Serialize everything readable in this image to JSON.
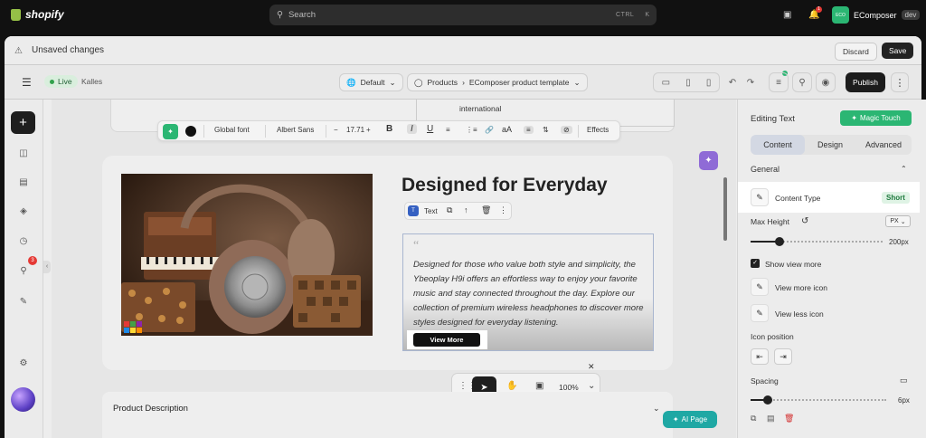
{
  "topbar": {
    "brand": "shopify",
    "search_placeholder": "Search",
    "shortcut_a": "CTRL",
    "shortcut_b": "K",
    "notification_count": "1",
    "store_initials": "ECO",
    "store_name": "EComposer",
    "store_env": "dev"
  },
  "unsaved_bar": {
    "label": "Unsaved changes",
    "discard": "Discard",
    "save": "Save"
  },
  "editor_toolbar": {
    "status": "Live",
    "theme": "Kalles",
    "language": "Default",
    "breadcrumb_root": "Products",
    "breadcrumb_page": "EComposer product template",
    "publish": "Publish"
  },
  "left_rail": {
    "badge_count": "3"
  },
  "canvas": {
    "prev_text": "international",
    "format_bar": {
      "font_scope": "Global font",
      "font_family": "Albert Sans",
      "font_size": "17.71",
      "bold": "B",
      "italic": "I",
      "underline": "U",
      "case": "aA",
      "effects": "Effects"
    },
    "heading": "Designed for Everyday",
    "element_label": "Text",
    "paragraph": "Designed for those who value both style and simplicity, the Ybeoplay H9i offers an effortless way to enjoy your favorite music and stay connected throughout the day. Explore our collection of premium wireless headphones to discover more styles designed for everyday listening.",
    "view_more": "View More",
    "zoom": "100%",
    "product_description": "Product Description",
    "ai_page": "AI Page"
  },
  "panel": {
    "title": "Editing Text",
    "magic_touch": "Magic Touch",
    "tabs": [
      "Content",
      "Design",
      "Advanced"
    ],
    "section_general": "General",
    "content_type_label": "Content Type",
    "content_type_value": "Short",
    "max_height_label": "Max Height",
    "unit": "PX",
    "max_height_value": "200px",
    "max_height_fraction": 0.22,
    "show_view_more": "Show view more",
    "view_more_icon": "View more icon",
    "view_less_icon": "View less icon",
    "icon_position": "Icon position",
    "spacing_label": "Spacing",
    "spacing_value": "6px",
    "spacing_fraction": 0.12
  },
  "colors": {
    "accent_green": "#2bb673",
    "dark": "#1e1e1e",
    "ai_teal": "#1fa8a4",
    "sparkle_purple": "#8f6bd6"
  }
}
